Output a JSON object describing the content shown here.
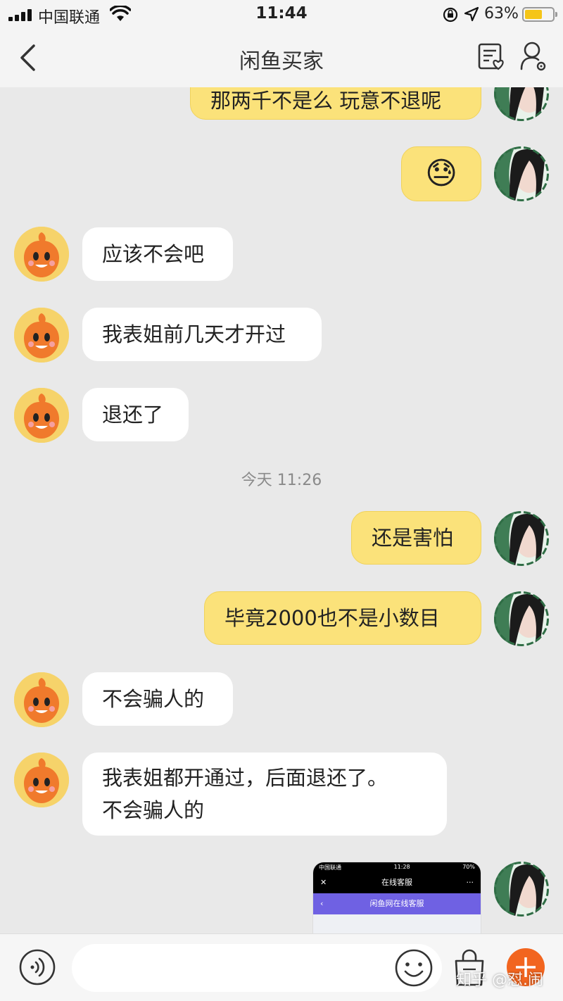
{
  "status_bar": {
    "carrier": "中国联通",
    "time": "11:44",
    "battery_percent": "63%",
    "battery_level": 0.63
  },
  "nav": {
    "title": "闲鱼买家",
    "back_icon": "chevron-left-icon",
    "note_icon": "note-heart-icon",
    "user_settings_icon": "user-gear-icon"
  },
  "messages": [
    {
      "side": "me",
      "text": "那两千不是么 玩意不退呢"
    },
    {
      "side": "me",
      "text": "😓"
    },
    {
      "side": "them",
      "text": "应该不会吧"
    },
    {
      "side": "them",
      "text": "我表姐前几天才开过"
    },
    {
      "side": "them",
      "text": "退还了"
    },
    {
      "side": "me",
      "text": "还是害怕"
    },
    {
      "side": "me",
      "text": "毕竟2000也不是小数目"
    },
    {
      "side": "them",
      "text": "不会骗人的"
    },
    {
      "side": "them",
      "lines": [
        "我表姐都开通过，后面退还了。",
        "不会骗人的"
      ]
    }
  ],
  "timestamp": "今天 11:26",
  "screenshot_message": {
    "carrier": "中国联通",
    "time": "11:28",
    "battery": "70%",
    "header_title": "在线客服",
    "sub_title": "闲鱼网在线客服"
  },
  "input_bar": {
    "voice_icon": "voice-icon",
    "emoji_icon": "emoji-icon",
    "bag_icon": "shopping-bag-icon",
    "plus_icon": "plus-icon"
  },
  "watermark": "知乎 @怼.闹",
  "colors": {
    "my_bubble": "#fbe27a",
    "their_bubble": "#ffffff",
    "background": "#e9e9e9",
    "plus_button": "#f2651f"
  }
}
